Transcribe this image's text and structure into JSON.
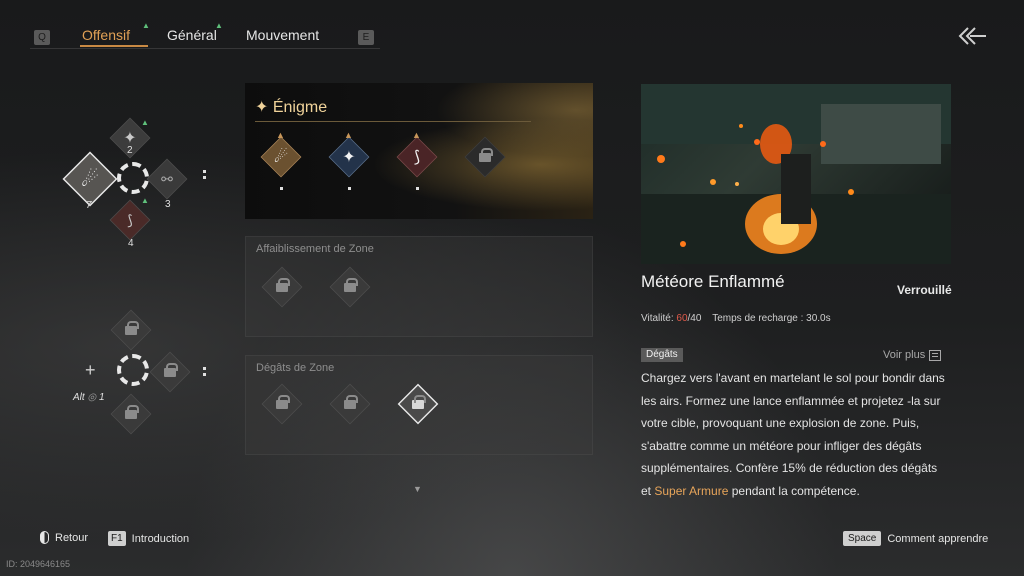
{
  "tabs": {
    "prev_key": "Q",
    "next_key": "E",
    "items": [
      {
        "label": "Offensif",
        "active": true
      },
      {
        "label": "Général",
        "active": false
      },
      {
        "label": "Mouvement",
        "active": false
      }
    ]
  },
  "loadout": {
    "top_slots": {
      "top": "2",
      "right": "3",
      "bottom": "4",
      "left": "7"
    },
    "bottom_slots": {
      "left_symbol": "+",
      "hotkey": "Alt",
      "hotkey_num": "1"
    }
  },
  "enigme": {
    "title": "Énigme"
  },
  "sections": {
    "zone_weaken": {
      "title": "Affaiblissement de Zone"
    },
    "zone_damage": {
      "title": "Dégâts de Zone"
    }
  },
  "detail": {
    "skill_name": "Météore Enflammé",
    "status": "Verrouillé",
    "vitality_label": "Vitalité:",
    "vitality_current": "60",
    "vitality_max": "/40",
    "cooldown": "Temps de recharge : 30.0s",
    "tag": "Dégâts",
    "see_more": "Voir plus",
    "desc_1": "Chargez vers l'avant en martelant le sol pour bondir dans les airs. Formez une lance enflammée et projetez -la sur votre cible, provoquant une explosion de zone. Puis, s'abattre comme un météore pour infliger des dégâts supplémentaires. Confère 15% de réduction des dégâts et ",
    "desc_highlight": "Super Armure",
    "desc_2": " pendant la compétence."
  },
  "footer": {
    "back_label": "Retour",
    "intro_key": "F1",
    "intro_label": "Introduction",
    "space_key": "Space",
    "learn_label": "Comment apprendre",
    "id_text": "ID: 2049646165"
  },
  "colors": {
    "accent": "#e2a156",
    "green_arrow": "#5fc07b",
    "vitality_red": "#e05a4a"
  }
}
